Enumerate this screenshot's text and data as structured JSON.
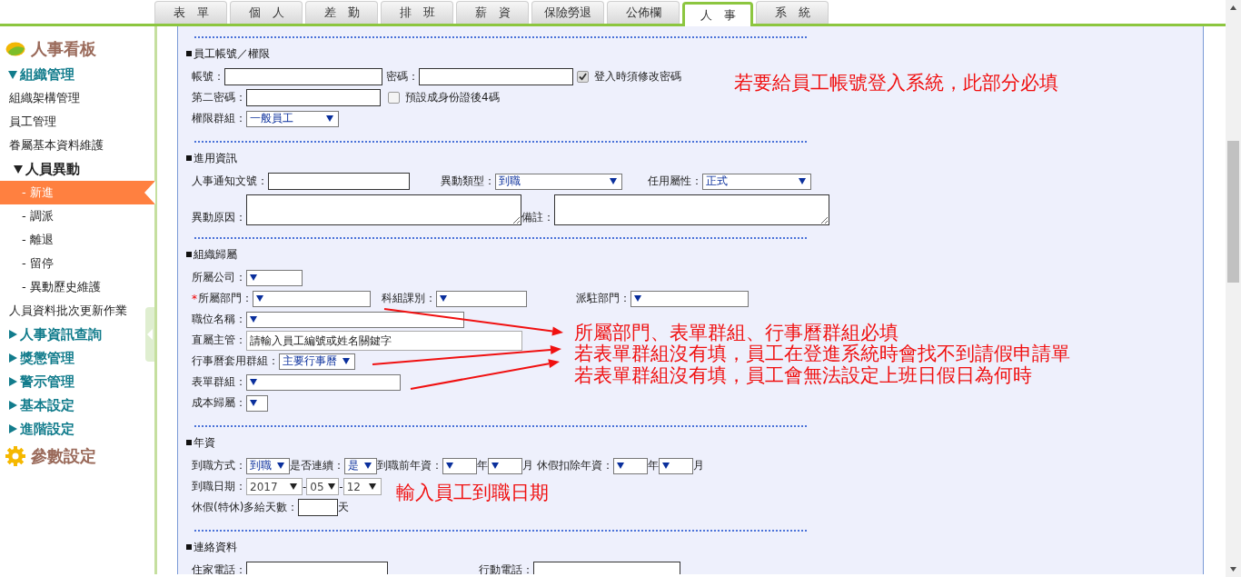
{
  "tabs": [
    {
      "label": "表　單",
      "selected": false
    },
    {
      "label": "個　人",
      "selected": false
    },
    {
      "label": "差　勤",
      "selected": false
    },
    {
      "label": "排　班",
      "selected": false
    },
    {
      "label": "薪　資",
      "selected": false
    },
    {
      "label": "保險勞退",
      "selected": false
    },
    {
      "label": "公佈欄",
      "selected": false
    },
    {
      "label": "人　事",
      "selected": true
    },
    {
      "label": "系　統",
      "selected": false
    }
  ],
  "sidebar": {
    "title": "人事看板",
    "items": [
      {
        "kind": "group",
        "label": "組織管理",
        "expanded": true,
        "children": [
          {
            "kind": "link",
            "label": "組織架構管理",
            "selected": false
          },
          {
            "kind": "link",
            "label": "員工管理",
            "selected": false
          },
          {
            "kind": "link",
            "label": "眷屬基本資料維護",
            "selected": false
          },
          {
            "kind": "subgroup",
            "label": "人員異動",
            "expanded": true,
            "children": [
              {
                "kind": "link",
                "label": "- 新進",
                "selected": true
              },
              {
                "kind": "link",
                "label": "- 調派",
                "selected": false
              },
              {
                "kind": "link",
                "label": "- 離退",
                "selected": false
              },
              {
                "kind": "link",
                "label": "- 留停",
                "selected": false
              },
              {
                "kind": "link",
                "label": "- 異動歷史維護",
                "selected": false
              }
            ]
          },
          {
            "kind": "link",
            "label": "人員資料批次更新作業",
            "selected": false
          }
        ]
      },
      {
        "kind": "group",
        "label": "人事資訊查詢",
        "expanded": false
      },
      {
        "kind": "group",
        "label": "獎懲管理",
        "expanded": false
      },
      {
        "kind": "group",
        "label": "警示管理",
        "expanded": false
      },
      {
        "kind": "group",
        "label": "基本設定",
        "expanded": false
      },
      {
        "kind": "group",
        "label": "進階設定",
        "expanded": false
      }
    ],
    "footer": "參數設定"
  },
  "sections": [
    {
      "title": "員工帳號／權限",
      "rows": [
        {
          "fields": [
            {
              "kind": "label",
              "text": "帳號："
            },
            {
              "kind": "input"
            },
            {
              "kind": "label",
              "text": "密碼："
            },
            {
              "kind": "input"
            },
            {
              "kind": "checkbox",
              "text": "登入時須修改密碼",
              "checked": true
            }
          ]
        },
        {
          "fields": [
            {
              "kind": "label",
              "text": "第二密碼："
            },
            {
              "kind": "input"
            },
            {
              "kind": "checkbox",
              "text": "預設成身份證後4碼",
              "checked": false
            }
          ]
        },
        {
          "fields": [
            {
              "kind": "label",
              "text": "權限群組："
            },
            {
              "kind": "select",
              "value": "一般員工"
            }
          ]
        }
      ]
    },
    {
      "title": "進用資訊",
      "rows": [
        {
          "fields": [
            {
              "kind": "label",
              "text": "人事通知文號："
            },
            {
              "kind": "input"
            },
            {
              "kind": "label",
              "text": "異動類型："
            },
            {
              "kind": "select",
              "value": "到職"
            },
            {
              "kind": "label",
              "text": "任用屬性："
            },
            {
              "kind": "select",
              "value": "正式"
            }
          ]
        },
        {
          "fields": [
            {
              "kind": "label",
              "text": "異動原因："
            },
            {
              "kind": "textarea"
            },
            {
              "kind": "label",
              "text": "備註："
            },
            {
              "kind": "textarea"
            }
          ]
        }
      ]
    },
    {
      "title": "組織歸屬",
      "rows": [
        {
          "fields": [
            {
              "kind": "label",
              "text": "所屬公司："
            },
            {
              "kind": "select"
            }
          ]
        },
        {
          "fields": [
            {
              "kind": "label",
              "mark": "*",
              "text": "所屬部門："
            },
            {
              "kind": "select"
            },
            {
              "kind": "label",
              "text": "科組課別："
            },
            {
              "kind": "select"
            },
            {
              "kind": "label",
              "text": "派駐部門："
            },
            {
              "kind": "select"
            }
          ]
        },
        {
          "fields": [
            {
              "kind": "label",
              "text": "職位名稱："
            },
            {
              "kind": "select"
            }
          ]
        },
        {
          "fields": [
            {
              "kind": "label",
              "text": "直屬主管："
            },
            {
              "kind": "input",
              "placeholder": "請輸入員工編號或姓名關鍵字"
            }
          ]
        },
        {
          "fields": [
            {
              "kind": "label",
              "text": "行事曆套用群組："
            },
            {
              "kind": "select",
              "value": "主要行事曆"
            }
          ]
        },
        {
          "fields": [
            {
              "kind": "label",
              "text": "表單群組："
            },
            {
              "kind": "select"
            }
          ]
        },
        {
          "fields": [
            {
              "kind": "label",
              "text": "成本歸屬："
            },
            {
              "kind": "select"
            }
          ]
        }
      ]
    },
    {
      "title": "年資",
      "rows": [
        {
          "fields": [
            {
              "kind": "label",
              "text": "到職方式："
            },
            {
              "kind": "select",
              "value": "到職"
            },
            {
              "kind": "label",
              "text": "是否連續："
            },
            {
              "kind": "select",
              "value": "是"
            },
            {
              "kind": "label",
              "text": "到職前年資："
            },
            {
              "kind": "select"
            },
            {
              "kind": "unit",
              "text": "年"
            },
            {
              "kind": "select"
            },
            {
              "kind": "unit",
              "text": "月"
            },
            {
              "kind": "label",
              "text": "休假扣除年資："
            },
            {
              "kind": "select"
            },
            {
              "kind": "unit",
              "text": "年"
            },
            {
              "kind": "select"
            },
            {
              "kind": "unit",
              "text": "月"
            }
          ]
        },
        {
          "fields": [
            {
              "kind": "label",
              "text": "到職日期："
            },
            {
              "kind": "date-select",
              "value": "2017"
            },
            {
              "kind": "unit",
              "text": "-"
            },
            {
              "kind": "date-select",
              "value": "05"
            },
            {
              "kind": "unit",
              "text": "-"
            },
            {
              "kind": "date-select",
              "value": "12"
            }
          ]
        },
        {
          "fields": [
            {
              "kind": "label",
              "text": "休假(特休)多給天數："
            },
            {
              "kind": "input"
            },
            {
              "kind": "unit",
              "text": "天"
            }
          ]
        }
      ]
    },
    {
      "title": "連絡資料",
      "rows": [
        {
          "fields": [
            {
              "kind": "label",
              "text": "住家電話："
            },
            {
              "kind": "input"
            },
            {
              "kind": "label",
              "text": "行動電話："
            },
            {
              "kind": "input"
            }
          ]
        }
      ]
    }
  ],
  "annotations": [
    {
      "text": "若要給員工帳號登入系統，此部分必填"
    },
    {
      "text": "所屬部門、表單群組、行事曆群組必填"
    },
    {
      "text": "若表單群組沒有填，員工在登進系統時會找不到請假申請單"
    },
    {
      "text": "若表單群組沒有填，員工會無法設定上班日假日為何時"
    },
    {
      "text": "輸入員工到職日期"
    }
  ]
}
